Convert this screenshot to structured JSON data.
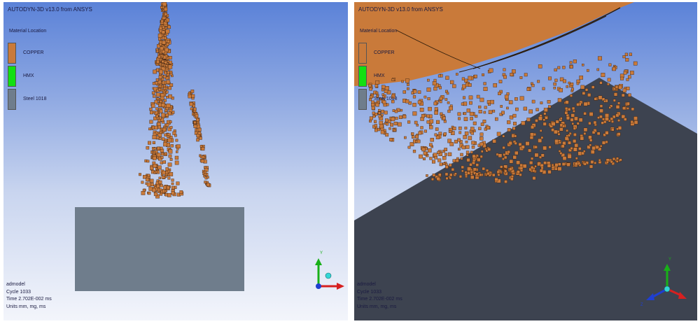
{
  "app": {
    "title": "AUTODYN-3D v13.0 from ANSYS"
  },
  "legend": {
    "title": "Material Location",
    "items": [
      {
        "label": "COPPER",
        "color": "#c97a3a"
      },
      {
        "label": "HMX",
        "color": "#12e012"
      },
      {
        "label": "Steel 1018",
        "color": "#6f7d8c"
      }
    ]
  },
  "info": {
    "model": "admodel",
    "cycle": "Cycle 1033",
    "time": "Time 2.702E-002 ms",
    "units": "Units mm, mg, ms"
  },
  "axes": {
    "y": "Y",
    "z": "Z"
  },
  "colors": {
    "copper": "#c97a3a",
    "target": "#6f7d8c",
    "target_dark": "#3d4350",
    "axis_x": "#d62020",
    "axis_y": "#18b018",
    "axis_z": "#1f3fd0",
    "origin": "#33d6d6"
  }
}
